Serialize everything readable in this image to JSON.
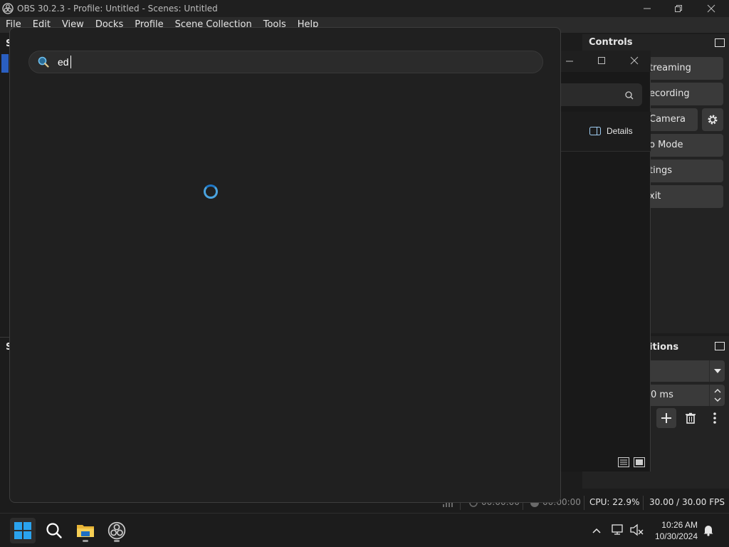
{
  "obs": {
    "title": "OBS 30.2.3 - Profile: Untitled - Scenes: Untitled",
    "menu": [
      "File",
      "Edit",
      "View",
      "Docks",
      "Profile",
      "Scene Collection",
      "Tools",
      "Help"
    ],
    "docks": {
      "scenes_initial": "S",
      "sources_initial": "S",
      "controls_title": "Controls",
      "transitions_title_partial": "itions"
    },
    "controls": {
      "buttons": [
        "treaming",
        "ecording",
        "Camera",
        "o Mode",
        "tings",
        "xit"
      ]
    },
    "transitions": {
      "duration_partial": "0 ms"
    },
    "status": {
      "stream_time": "00:00:00",
      "record_time": "00:00:00",
      "cpu": "CPU: 22.9%",
      "fps": "30.00 / 30.00 FPS"
    }
  },
  "explorer": {
    "details_label": "Details"
  },
  "search": {
    "query": "ed",
    "loading": true
  },
  "taskbar": {
    "time": "10:26 AM",
    "date": "10/30/2024",
    "colors": {
      "accent": "#4aa3df",
      "start": "#2aa3ef"
    }
  }
}
